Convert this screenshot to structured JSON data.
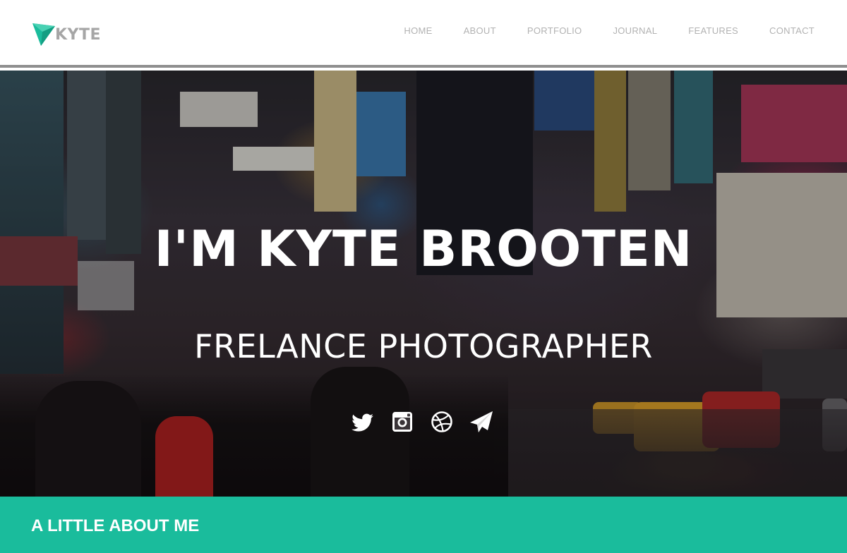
{
  "header": {
    "logo_text": "KYTE",
    "accent_color": "#1abc9c",
    "nav": [
      {
        "label": "HOME"
      },
      {
        "label": "ABOUT"
      },
      {
        "label": "PORTFOLIO"
      },
      {
        "label": "JOURNAL"
      },
      {
        "label": "FEATURES"
      },
      {
        "label": "CONTACT"
      }
    ]
  },
  "hero": {
    "title": "I'M KYTE BROOTEN",
    "subtitle": "FRELANCE PHOTOGRAPHER",
    "social_icons": [
      "twitter-icon",
      "instagram-icon",
      "dribbble-icon",
      "paper-plane-icon"
    ]
  },
  "about": {
    "heading": "A LITTLE ABOUT ME"
  }
}
